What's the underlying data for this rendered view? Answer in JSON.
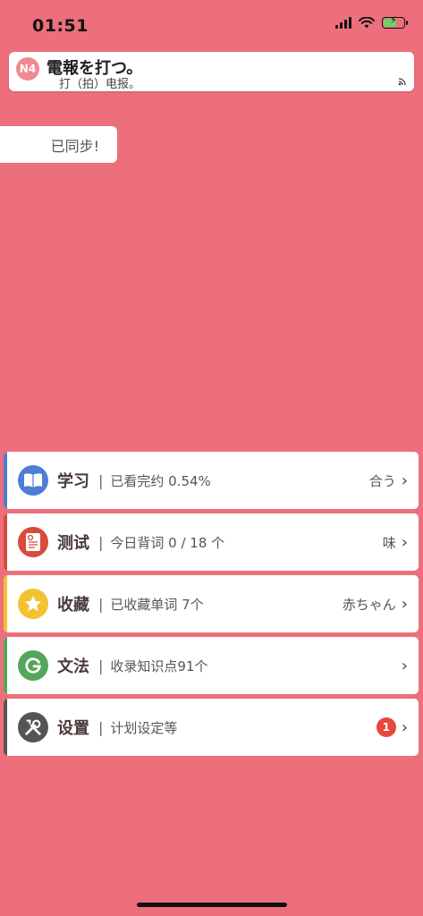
{
  "status_bar": {
    "time": "01:51"
  },
  "banner": {
    "level_badge": "N4",
    "title": "電報を打つ。",
    "subtitle": "打（拍）电报。"
  },
  "toast": {
    "text": "已同步!"
  },
  "menu": {
    "items": [
      {
        "title": "学习",
        "desc": "已看完约 0.54%",
        "right": "合う",
        "accent": "#4e7dd6",
        "icon_color": "#4e7dd6",
        "icon": "book-icon"
      },
      {
        "title": "测试",
        "desc": "今日背词 0 / 18 个",
        "right": "味",
        "accent": "#d94b3b",
        "icon_color": "#d94b3b",
        "icon": "test-sheet-icon"
      },
      {
        "title": "收藏",
        "desc": "已收藏单词 7个",
        "right": "赤ちゃん",
        "accent": "#f2c230",
        "icon_color": "#f2c230",
        "icon": "star-icon"
      },
      {
        "title": "文法",
        "desc": "收录知识点91个",
        "right": "",
        "accent": "#54a65a",
        "icon_color": "#54a65a",
        "icon": "grammar-g-icon"
      },
      {
        "title": "设置",
        "desc": "计划设定等",
        "right": "",
        "badge": "1",
        "accent": "#555555",
        "icon_color": "#555555",
        "icon": "tools-icon"
      }
    ]
  }
}
